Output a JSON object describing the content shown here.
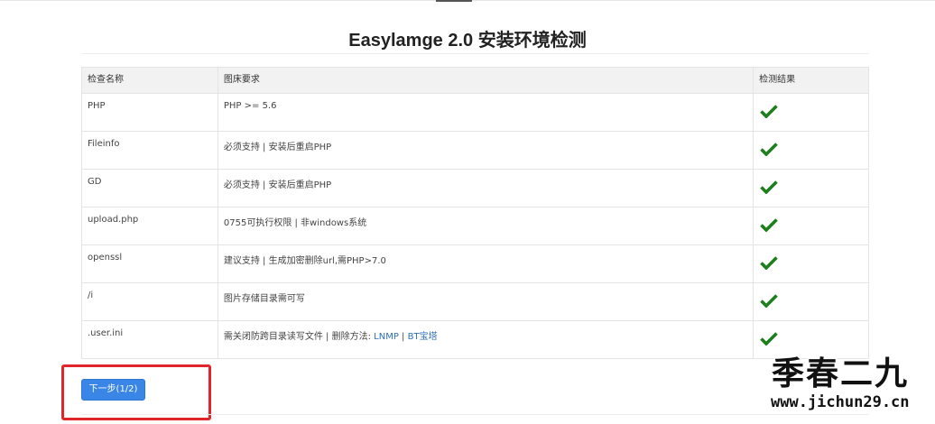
{
  "title": "Easylamge 2.0 安装环境检测",
  "table": {
    "headers": [
      "检查名称",
      "图床要求",
      "检测结果"
    ],
    "rows": [
      {
        "name": "PHP",
        "requirement": "PHP >= 5.6",
        "result": "pass"
      },
      {
        "name": "Fileinfo",
        "requirement": "必须支持 | 安装后重启PHP",
        "result": "pass"
      },
      {
        "name": "GD",
        "requirement": "必须支持 | 安装后重启PHP",
        "result": "pass"
      },
      {
        "name": "upload.php",
        "requirement": "0755可执行权限 | 非windows系统",
        "result": "pass"
      },
      {
        "name": "openssl",
        "requirement": "建议支持 | 生成加密删除url,需PHP>7.0",
        "result": "pass"
      },
      {
        "name": "/i",
        "requirement": "图片存储目录需可写",
        "result": "pass"
      },
      {
        "name": ".user.ini",
        "requirement": "需关闭防跨目录读写文件 | 删除方法: ",
        "links": [
          "LNMP",
          "BT宝塔"
        ],
        "link_sep": " | ",
        "result": "pass"
      }
    ]
  },
  "next_button": "下一步(1/2)",
  "watermark": {
    "text": "季春二九",
    "url": "www.jichun29.cn"
  },
  "colors": {
    "check": "#1e7e1e",
    "button": "#3a86e6",
    "highlight": "#e0252b",
    "link": "#2d6fb5"
  },
  "icons": {
    "result": "check-icon"
  }
}
